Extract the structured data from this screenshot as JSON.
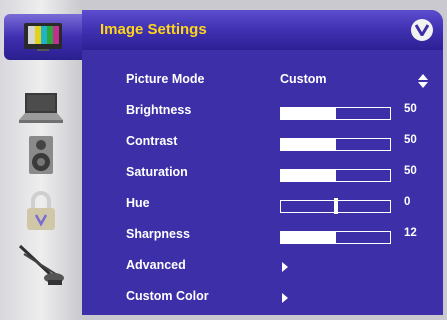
{
  "title": "Image Settings",
  "sidebar": {
    "items": [
      {
        "icon": "tv-screen-icon",
        "active": true
      },
      {
        "icon": "laptop-icon",
        "active": false
      },
      {
        "icon": "speaker-icon",
        "active": false
      },
      {
        "icon": "padlock-icon",
        "active": false
      },
      {
        "icon": "satellite-dish-icon",
        "active": false
      }
    ]
  },
  "badge_icon": "vizio-v-logo-icon",
  "colors": {
    "title": "#ffd51a",
    "panel": "#3c2fa8",
    "header": "#4133b4",
    "text": "#ffffff"
  },
  "settings": {
    "picture_mode": {
      "label": "Picture Mode",
      "value": "Custom"
    },
    "brightness": {
      "label": "Brightness",
      "value": "50",
      "fraction": 0.5
    },
    "contrast": {
      "label": "Contrast",
      "value": "50",
      "fraction": 0.5
    },
    "saturation": {
      "label": "Saturation",
      "value": "50",
      "fraction": 0.5
    },
    "hue": {
      "label": "Hue",
      "value": "0",
      "fraction": 0.5
    },
    "sharpness": {
      "label": "Sharpness",
      "value": "12",
      "fraction": 0.5
    },
    "advanced": {
      "label": "Advanced"
    },
    "custom_color": {
      "label": "Custom Color"
    }
  }
}
